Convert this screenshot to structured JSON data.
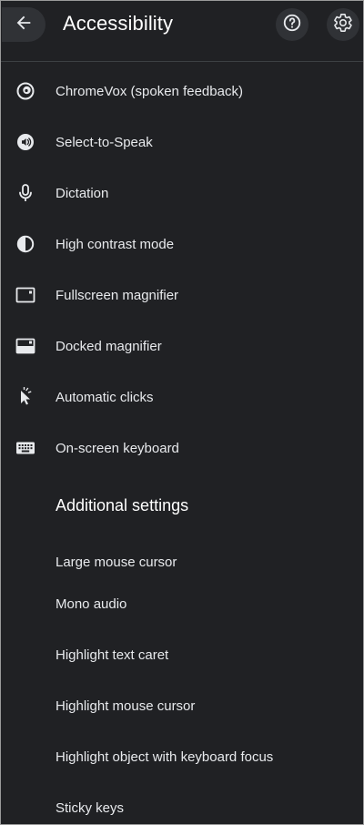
{
  "header": {
    "title": "Accessibility",
    "back_icon": "arrow-back-icon",
    "help_icon": "help-icon",
    "settings_icon": "gear-icon"
  },
  "features": [
    {
      "label": "ChromeVox (spoken feedback)",
      "icon": "chromevox-icon"
    },
    {
      "label": "Select-to-Speak",
      "icon": "select-to-speak-icon"
    },
    {
      "label": "Dictation",
      "icon": "microphone-icon"
    },
    {
      "label": "High contrast mode",
      "icon": "contrast-icon"
    },
    {
      "label": "Fullscreen magnifier",
      "icon": "fullscreen-magnifier-icon"
    },
    {
      "label": "Docked magnifier",
      "icon": "docked-magnifier-icon"
    },
    {
      "label": "Automatic clicks",
      "icon": "automatic-clicks-icon"
    },
    {
      "label": "On-screen keyboard",
      "icon": "keyboard-icon"
    }
  ],
  "additional": {
    "title": "Additional settings",
    "items": [
      {
        "label": "Large mouse cursor"
      },
      {
        "label": "Mono audio"
      },
      {
        "label": "Highlight text caret"
      },
      {
        "label": "Highlight mouse cursor"
      },
      {
        "label": "Highlight object with keyboard focus"
      },
      {
        "label": "Sticky keys"
      }
    ]
  },
  "colors": {
    "background": "#202124",
    "text": "#e8eaed",
    "title": "#ffffff",
    "button_bg": "#303236",
    "divider": "#3c4043"
  }
}
